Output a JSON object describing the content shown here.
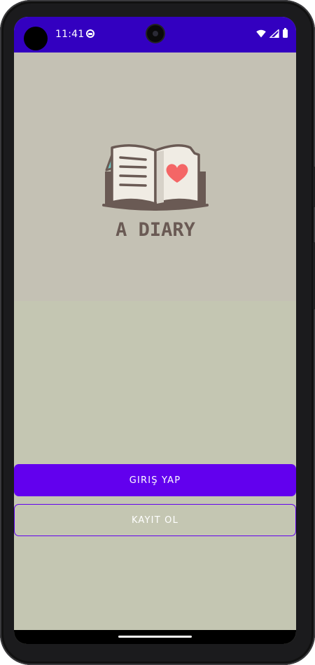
{
  "status_bar": {
    "time": "11:41",
    "background_color": "#3300c0",
    "icons": [
      "notification-icon",
      "wifi-icon",
      "signal-icon",
      "battery-icon"
    ]
  },
  "logo": {
    "text": "A DIARY",
    "icon": "open-book-heart-icon",
    "heart_color": "#f46666",
    "ink_color": "#6a5a54"
  },
  "buttons": {
    "login_label": "GIRIŞ YAP",
    "register_label": "KAYIT OL",
    "accent_color": "#6200ee"
  },
  "screen": {
    "background_color": "#c4c5b3"
  }
}
